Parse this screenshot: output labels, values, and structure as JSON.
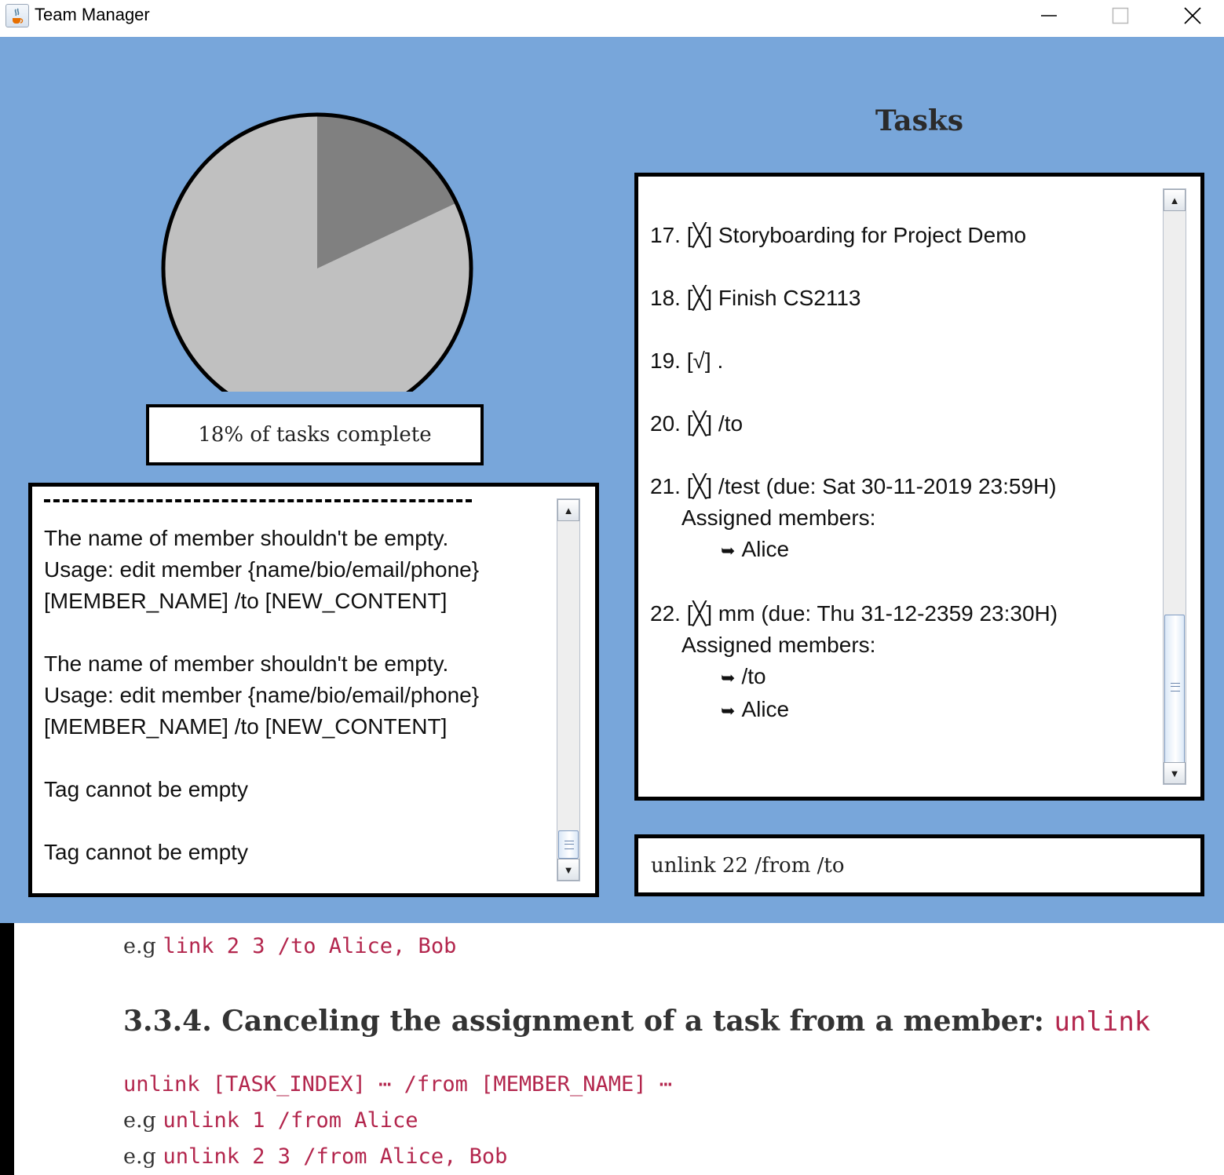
{
  "window": {
    "title": "Team Manager",
    "icon": "java-coffee-icon",
    "controls": [
      "minimize-icon",
      "maximize-icon",
      "close-icon"
    ]
  },
  "progress": {
    "completed_fraction": 0.18,
    "label": "18% of tasks complete",
    "colors": {
      "complete": "#808080",
      "incomplete": "#c0c0c0",
      "outline": "#000000"
    }
  },
  "log": {
    "entries": [
      {
        "lines": [
          "The name of member shouldn't be empty.",
          "Usage: edit member {name/bio/email/phone}",
          "[MEMBER_NAME] /to [NEW_CONTENT]"
        ]
      },
      {
        "lines": [
          "The name of member shouldn't be empty.",
          "Usage: edit member {name/bio/email/phone}",
          "[MEMBER_NAME] /to [NEW_CONTENT]"
        ]
      },
      {
        "lines": [
          "Tag cannot be empty"
        ]
      },
      {
        "lines": [
          "Tag cannot be empty"
        ]
      }
    ]
  },
  "tasks": {
    "title": "Tasks",
    "items": [
      {
        "index": "17.",
        "status": "[╳]",
        "name": "Storyboarding for Project Demo",
        "due": "",
        "assigned_label": "",
        "members": []
      },
      {
        "index": "18.",
        "status": "[╳]",
        "name": "Finish CS2113",
        "due": "",
        "assigned_label": "",
        "members": []
      },
      {
        "index": "19.",
        "status": "[√]",
        "name": ".",
        "due": "",
        "assigned_label": "",
        "members": []
      },
      {
        "index": "20.",
        "status": "[╳]",
        "name": "/to",
        "due": "",
        "assigned_label": "",
        "members": []
      },
      {
        "index": "21.",
        "status": "[╳]",
        "name": "/test",
        "due": "(due: Sat 30-11-2019 23:59H)",
        "assigned_label": "Assigned members:",
        "members": [
          "Alice"
        ]
      },
      {
        "index": "22.",
        "status": "[╳]",
        "name": "mm",
        "due": "(due: Thu 31-12-2359 23:30H)",
        "assigned_label": "Assigned members:",
        "members": [
          "/to",
          "Alice"
        ]
      }
    ]
  },
  "command": {
    "value": "unlink 22 /from /to"
  },
  "doc": {
    "eg_prefix": "e.g",
    "line1_code": "link 2 3 /to Alice, Bob",
    "heading_text": "3.3.4. Canceling the assignment of a task from a member: ",
    "heading_code": "unlink",
    "syntax": "unlink [TASK_INDEX] ⋯ /from [MEMBER_NAME] ⋯",
    "example1_code": "unlink 1 /from Alice",
    "example2_code": "unlink 2 3 /from Alice, Bob"
  }
}
